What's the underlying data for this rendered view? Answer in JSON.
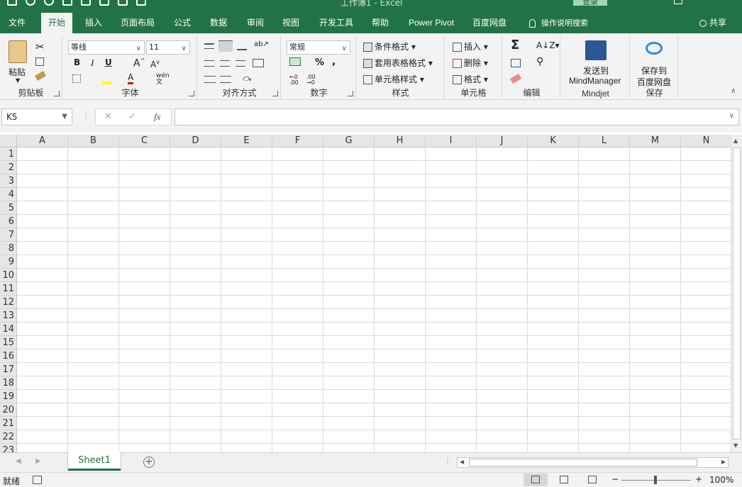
{
  "window": {
    "title": "工作簿1 - Excel",
    "login": "登录"
  },
  "tabs": [
    {
      "label": "文件"
    },
    {
      "label": "开始"
    },
    {
      "label": "插入"
    },
    {
      "label": "页面布局"
    },
    {
      "label": "公式"
    },
    {
      "label": "数据"
    },
    {
      "label": "审阅"
    },
    {
      "label": "视图"
    },
    {
      "label": "开发工具"
    },
    {
      "label": "帮助"
    },
    {
      "label": "Power Pivot"
    },
    {
      "label": "百度网盘"
    }
  ],
  "tell_me": "操作说明搜索",
  "share": "共享",
  "ribbon": {
    "clipboard": {
      "label": "剪贴板",
      "paste": "粘贴"
    },
    "font": {
      "label": "字体",
      "font_name": "等线",
      "font_size": "11",
      "bold": "B",
      "italic": "I",
      "underline": "U",
      "grow": "A",
      "shrink": "A",
      "font_color": "A",
      "phonetic": "wén 文"
    },
    "alignment": {
      "label": "对齐方式"
    },
    "number": {
      "label": "数字",
      "format": "常规",
      "percent": "%",
      "comma": ","
    },
    "styles": {
      "label": "样式",
      "conditional": "条件格式",
      "table": "套用表格格式",
      "cell_styles": "单元格样式"
    },
    "cells": {
      "label": "单元格",
      "insert": "插入",
      "delete": "删除",
      "format": "格式"
    },
    "editing": {
      "label": "编辑"
    },
    "mindjet": {
      "label": "Mindjet",
      "line1": "发送到",
      "line2": "MindManager"
    },
    "save": {
      "label": "保存",
      "line1": "保存到",
      "line2": "百度网盘"
    }
  },
  "formula_bar": {
    "name_box": "K5",
    "fx": "fx",
    "value": ""
  },
  "grid": {
    "columns": [
      "A",
      "B",
      "C",
      "D",
      "E",
      "F",
      "G",
      "H",
      "I",
      "J",
      "K",
      "L",
      "M",
      "N"
    ],
    "rows": [
      "1",
      "2",
      "3",
      "4",
      "5",
      "6",
      "7",
      "8",
      "9",
      "10",
      "11",
      "12",
      "13",
      "14",
      "15",
      "16",
      "17",
      "18",
      "19",
      "20",
      "21",
      "22",
      "23"
    ]
  },
  "sheets": [
    {
      "name": "Sheet1",
      "active": true
    }
  ],
  "status": {
    "ready": "就绪",
    "zoom": "100%"
  },
  "colors": {
    "brand": "#217346"
  }
}
